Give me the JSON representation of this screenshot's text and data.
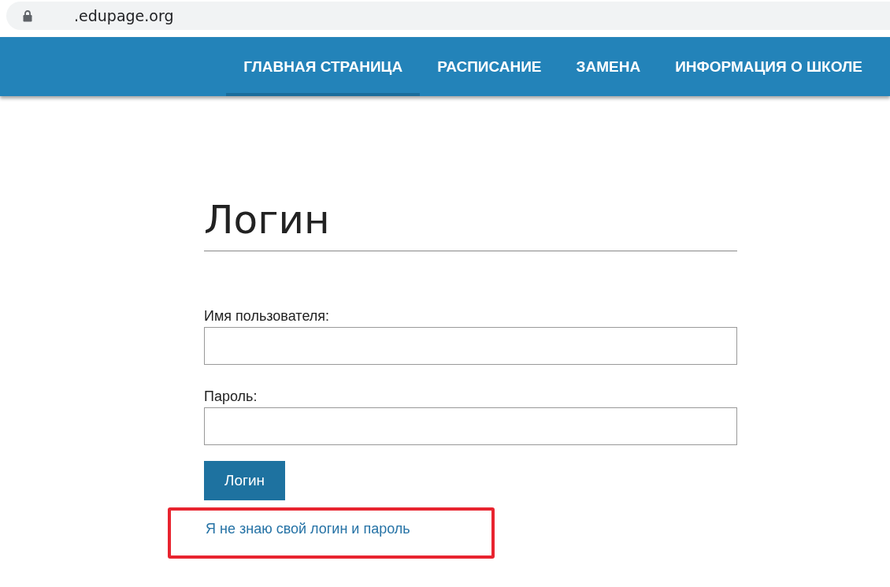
{
  "browser": {
    "address": ".edupage.org"
  },
  "nav": [
    {
      "label": "ГЛАВНАЯ СТРАНИЦА",
      "selected": true
    },
    {
      "label": "РАСПИСАНИЕ",
      "selected": false
    },
    {
      "label": "ЗАМЕНА",
      "selected": false
    },
    {
      "label": "ИНФОРМАЦИЯ О ШКОЛЕ",
      "selected": false
    }
  ],
  "login": {
    "title": "Логин",
    "fields": [
      {
        "label": "Имя пользователя:"
      },
      {
        "label": "Пароль:"
      }
    ],
    "submit": "Логин",
    "forgot_link": "Я не знаю свой логин и пароль",
    "forgot_highlighted": true
  }
}
